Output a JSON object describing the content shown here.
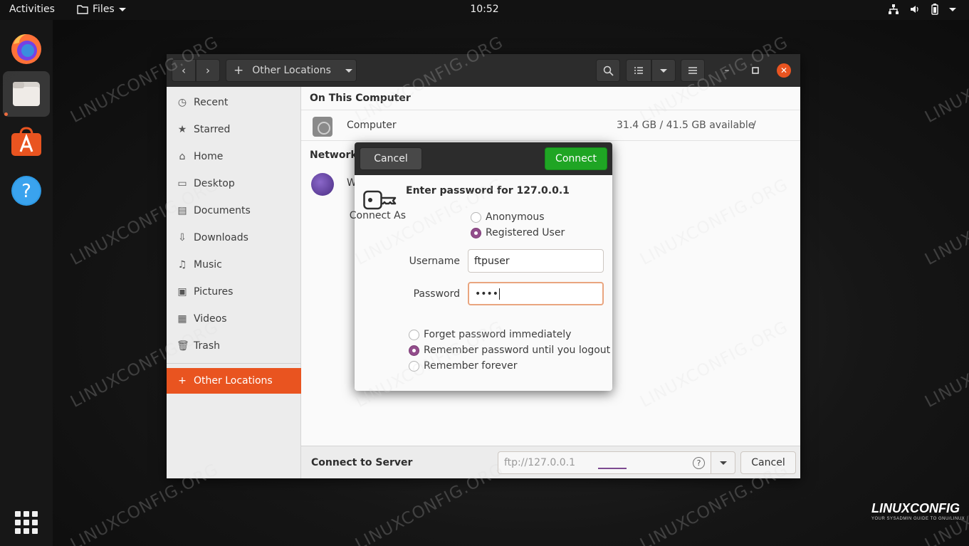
{
  "topbar": {
    "activities": "Activities",
    "app_menu": "Files",
    "clock": "10:52"
  },
  "dock": {
    "items": [
      {
        "icon": "firefox-icon"
      },
      {
        "icon": "files-icon",
        "active": true
      },
      {
        "icon": "software-center-icon"
      },
      {
        "icon": "help-icon"
      }
    ],
    "apps_grid_icon": "show-applications-icon"
  },
  "window": {
    "pathbar_label": "Other Locations",
    "sidebar": [
      {
        "label": "Recent",
        "icon": "clock"
      },
      {
        "label": "Starred",
        "icon": "star"
      },
      {
        "label": "Home",
        "icon": "home"
      },
      {
        "label": "Desktop",
        "icon": "desktop"
      },
      {
        "label": "Documents",
        "icon": "document"
      },
      {
        "label": "Downloads",
        "icon": "download"
      },
      {
        "label": "Music",
        "icon": "music"
      },
      {
        "label": "Pictures",
        "icon": "picture"
      },
      {
        "label": "Videos",
        "icon": "video"
      },
      {
        "label": "Trash",
        "icon": "trash"
      }
    ],
    "other_locations": "Other Locations",
    "on_this_computer": "On This Computer",
    "computer": {
      "name": "Computer",
      "space": "31.4 GB / 41.5 GB available",
      "mount": "/"
    },
    "networks_heading": "Networks",
    "network_item_initial": "W",
    "footer": {
      "label": "Connect to Server",
      "server_placeholder": "ftp://127.0.0.1",
      "help": "?",
      "cancel": "Cancel"
    }
  },
  "dialog": {
    "cancel": "Cancel",
    "connect": "Connect",
    "title": "Enter password for 127.0.0.1",
    "connect_as_label": "Connect As",
    "connect_as_options": [
      {
        "label": "Anonymous",
        "checked": false
      },
      {
        "label": "Registered User",
        "checked": true
      }
    ],
    "username_label": "Username",
    "username_value": "ftpuser",
    "password_label": "Password",
    "password_value": "••••",
    "remember_options": [
      {
        "label": "Forget password immediately",
        "checked": false
      },
      {
        "label": "Remember password until you logout",
        "checked": true
      },
      {
        "label": "Remember forever",
        "checked": false
      }
    ]
  },
  "watermark_text": "LINUXCONFIG.ORG",
  "logo": {
    "text": "LINUXCONFIG",
    "tagline": "YOUR SYSADMIN GUIDE TO GNU/LINUX"
  },
  "colors": {
    "accent": "#e95420",
    "connect_green": "#1fa524",
    "radio_purple": "#924d8b",
    "headerbar": "#2c2c2c"
  }
}
